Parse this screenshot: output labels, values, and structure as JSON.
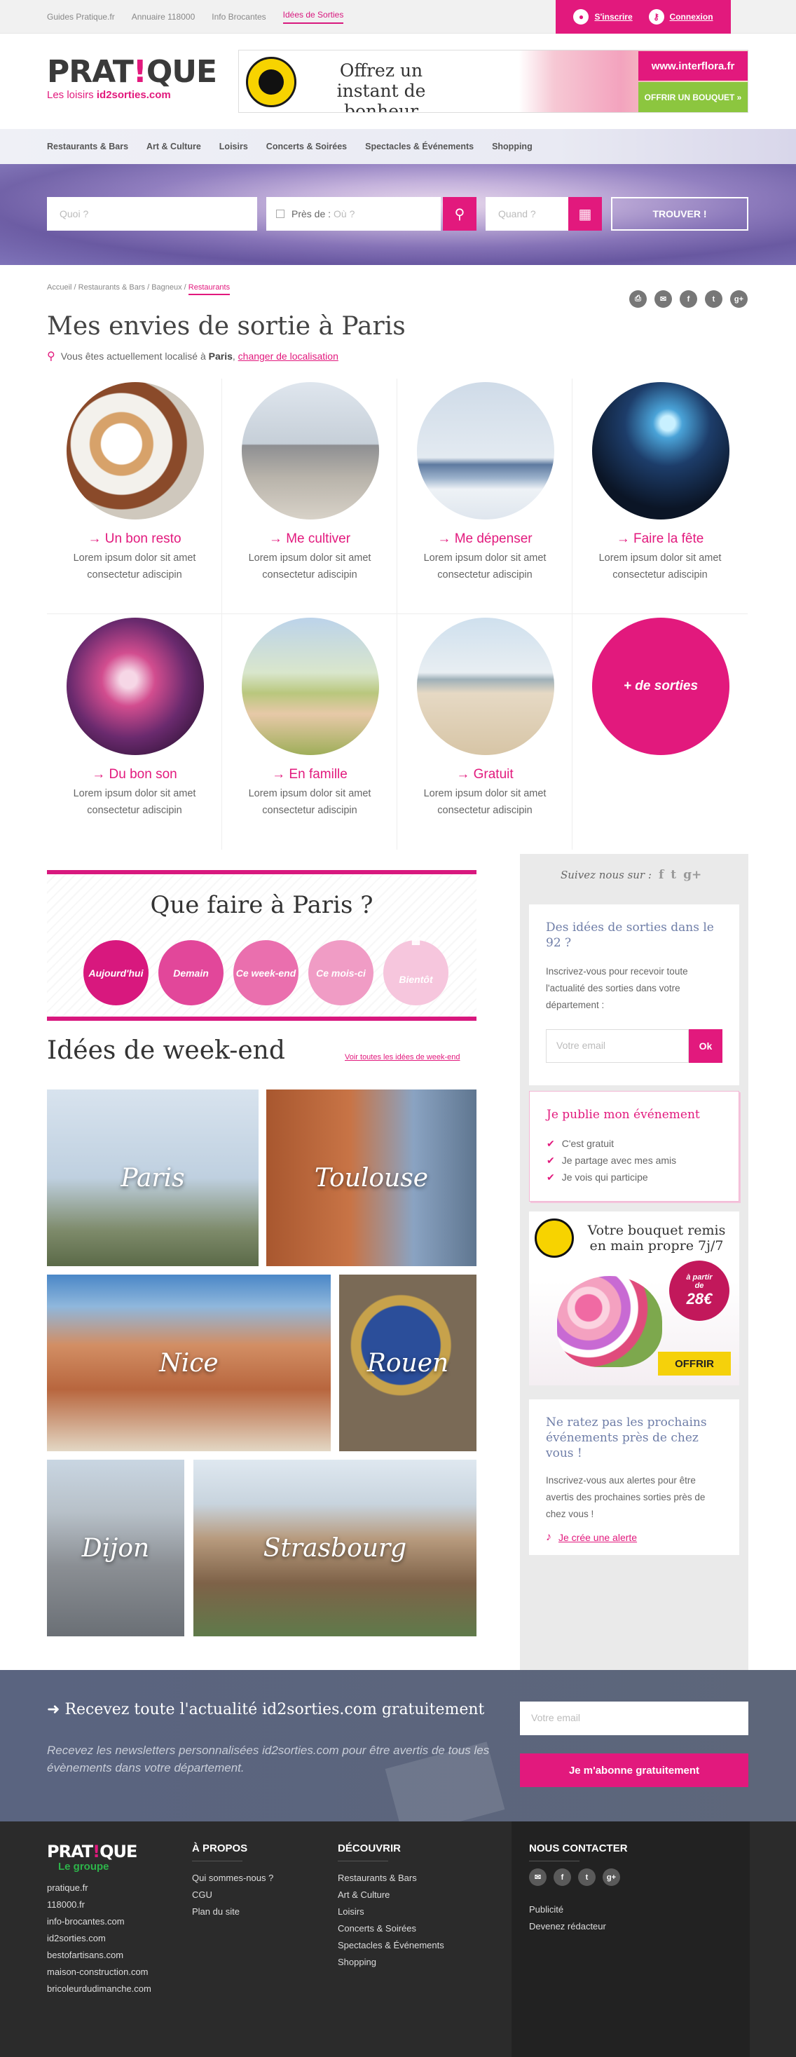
{
  "topbar": {
    "links": [
      "Guides Pratique.fr",
      "Annuaire 118000",
      "Info Brocantes",
      "Idées de Sorties"
    ],
    "signup": "S'inscrire",
    "login": "Connexion"
  },
  "logo": {
    "word_left": "PRAT",
    "word_bang": "!",
    "word_right": "QUE",
    "tag_prefix": "Les loisirs ",
    "tag_site": "id2sorties.com"
  },
  "ad": {
    "slogan": "Offrez un instant de bonheur",
    "url": "www.interflora.fr",
    "cta": "OFFRIR UN BOUQUET »"
  },
  "nav": {
    "categories": [
      "Restaurants & Bars",
      "Art & Culture",
      "Loisirs",
      "Concerts & Soirées",
      "Spectacles & Événements",
      "Shopping"
    ]
  },
  "search": {
    "what_placeholder": "Quoi ?",
    "near_label": "Près de :",
    "where_placeholder": "Où ?",
    "when_placeholder": "Quand ?",
    "submit": "TROUVER !"
  },
  "breadcrumb": {
    "items": [
      "Accueil",
      "Restaurants & Bars",
      "Bagneux"
    ],
    "current": "Restaurants"
  },
  "share_icons": [
    "print-icon",
    "mail-icon",
    "facebook-icon",
    "twitter-icon",
    "googleplus-icon"
  ],
  "page": {
    "title": "Mes envies de sortie à Paris",
    "location_text": "Vous êtes actuellement localisé à ",
    "location_city": "Paris",
    "location_link": "changer de localisation"
  },
  "envies": [
    {
      "title": "Un bon resto",
      "desc": "Lorem ipsum dolor sit amet consectetur adiscipin"
    },
    {
      "title": "Me cultiver",
      "desc": "Lorem ipsum dolor sit amet consectetur adiscipin"
    },
    {
      "title": "Me dépenser",
      "desc": "Lorem ipsum dolor sit amet consectetur adiscipin"
    },
    {
      "title": "Faire la fête",
      "desc": "Lorem ipsum dolor sit amet consectetur adiscipin"
    },
    {
      "title": "Du bon son",
      "desc": "Lorem ipsum dolor sit amet consectetur adiscipin"
    },
    {
      "title": "En famille",
      "desc": "Lorem ipsum dolor sit amet consectetur adiscipin"
    },
    {
      "title": "Gratuit",
      "desc": "Lorem ipsum dolor sit amet consectetur adiscipin"
    }
  ],
  "more_sorties": "+ de sorties",
  "quefaire": {
    "title": "Que faire à Paris ?",
    "options": [
      "Aujourd'hui",
      "Demain",
      "Ce week-end",
      "Ce mois-ci",
      "Bientôt"
    ]
  },
  "weekend": {
    "title": "Idées de week-end",
    "link": "Voir toutes les idées de week-end",
    "cities": [
      "Paris",
      "Toulouse",
      "Nice",
      "Rouen",
      "Dijon",
      "Strasbourg"
    ]
  },
  "sidebar": {
    "follow": "Suivez nous sur :",
    "newsletter_title": "Des idées de sorties dans le 92 ?",
    "newsletter_text": "Inscrivez-vous pour recevoir toute l'actualité des sorties dans votre département :",
    "email_placeholder": "Votre email",
    "ok": "Ok",
    "publish_title": "Je publie mon événement",
    "publish_items": [
      "C'est gratuit",
      "Je partage avec mes amis",
      "Je vois qui participe"
    ],
    "promo_title": "Votre bouquet remis en main propre 7j/7",
    "promo_price_prefix": "à partir de",
    "promo_price": "28€",
    "promo_cta": "OFFRIR",
    "alert_title": "Ne ratez pas les prochains événements près de chez vous !",
    "alert_text": "Inscrivez-vous aux alertes pour être avertis des prochaines sorties près de chez vous !",
    "alert_link": "Je crée une alerte"
  },
  "newsletter_band": {
    "title": "Recevez toute l'actualité id2sorties.com gratuitement",
    "text": "Recevez les newsletters personnalisées id2sorties.com pour être avertis de tous les évènements dans votre département.",
    "email_placeholder": "Votre email",
    "button": "Je m'abonne gratuitement"
  },
  "footer": {
    "logo_left": "PRAT",
    "logo_bang": "!",
    "logo_right": "QUE",
    "logo_sub": "Le groupe",
    "group_links": [
      "pratique.fr",
      "118000.fr",
      "info-brocantes.com",
      "id2sorties.com",
      "bestofartisans.com",
      "maison-construction.com",
      "bricoleurdudimanche.com"
    ],
    "about_title": "À PROPOS",
    "about_links": [
      "Qui sommes-nous ?",
      "CGU",
      "Plan du site"
    ],
    "discover_title": "DÉCOUVRIR",
    "discover_links": [
      "Restaurants & Bars",
      "Art & Culture",
      "Loisirs",
      "Concerts & Soirées",
      "Spectacles & Événements",
      "Shopping"
    ],
    "contact_title": "NOUS CONTACTER",
    "contact_links": [
      "Publicité",
      "Devenez rédacteur"
    ]
  },
  "colors": {
    "accent": "#e2197d",
    "footer_bg": "#2b2b2b",
    "band_bg": "#5d667a"
  }
}
